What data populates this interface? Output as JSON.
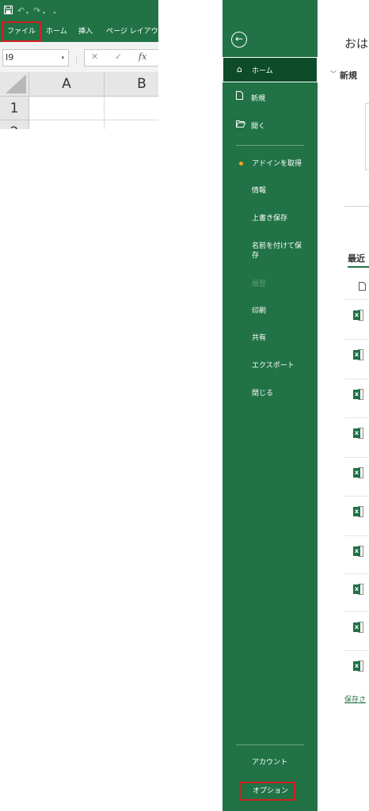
{
  "excel": {
    "tabs": {
      "file": "ファイル",
      "home": "ホーム",
      "insert": "挿入",
      "page_layout": "ページ レイアウト"
    },
    "name_box": {
      "value": "I9"
    },
    "formula_bar": {
      "cancel_glyph": "✕",
      "enter_glyph": "✓",
      "fx_label": "fx"
    },
    "grid": {
      "columns": [
        "A",
        "B"
      ],
      "rows": [
        "1",
        "2"
      ]
    },
    "qat_icons": [
      "save-icon",
      "undo-icon",
      "redo-icon",
      "customize-icon"
    ]
  },
  "backstage": {
    "nav": {
      "home": "ホーム",
      "new": "新規",
      "open": "開く",
      "get_addins": "アドインを取得",
      "info": "情報",
      "save": "上書き保存",
      "save_as": "名前を付けて保存",
      "history": "履歴",
      "print": "印刷",
      "share": "共有",
      "export": "エクスポート",
      "close": "閉じる",
      "account": "アカウント",
      "options": "オプション"
    },
    "content": {
      "greeting": "おは",
      "new_section": "新規",
      "recent_label": "最近",
      "saved_link": "保存さ"
    },
    "recent_files_count_visible": 10
  },
  "colors": {
    "excel_green": "#217346",
    "nav_selected": "#0e4b28",
    "highlight_red": "#d02020",
    "addin_dot": "#f2a51b"
  }
}
